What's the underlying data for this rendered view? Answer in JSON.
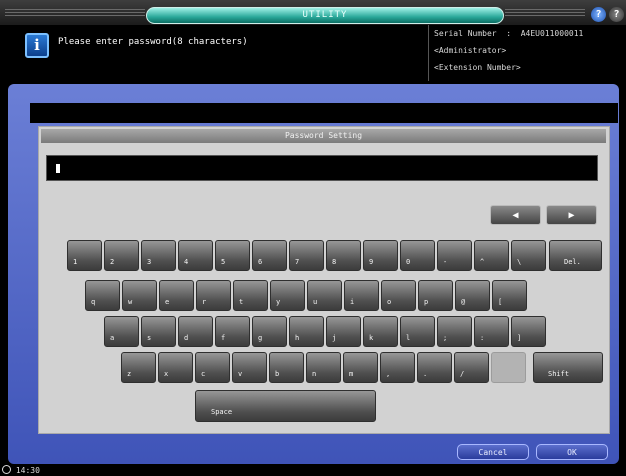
{
  "header": {
    "title": "UTILITY"
  },
  "message": {
    "text": "Please enter password(8 characters)"
  },
  "device_info": {
    "serial_label": "Serial Number",
    "serial_value": "A4EU011000011",
    "role": "<Administrator>",
    "extension": "<Extension Number>"
  },
  "panel": {
    "title": "Password Setting"
  },
  "keyboard": {
    "row1": [
      "1",
      "2",
      "3",
      "4",
      "5",
      "6",
      "7",
      "8",
      "9",
      "0",
      "-",
      "^",
      "\\",
      "Del."
    ],
    "row2": [
      "q",
      "w",
      "e",
      "r",
      "t",
      "y",
      "u",
      "i",
      "o",
      "p",
      "@",
      "["
    ],
    "row3": [
      "a",
      "s",
      "d",
      "f",
      "g",
      "h",
      "j",
      "k",
      "l",
      ";",
      ":",
      "]"
    ],
    "row4": [
      "z",
      "x",
      "c",
      "v",
      "b",
      "n",
      "m",
      ",",
      ".",
      "/",
      "",
      "Shift"
    ],
    "space_label": "Space",
    "left_arrow": "◀",
    "right_arrow": "▶"
  },
  "footer": {
    "cancel_label": "Cancel",
    "ok_label": "OK",
    "time": "14:30"
  }
}
